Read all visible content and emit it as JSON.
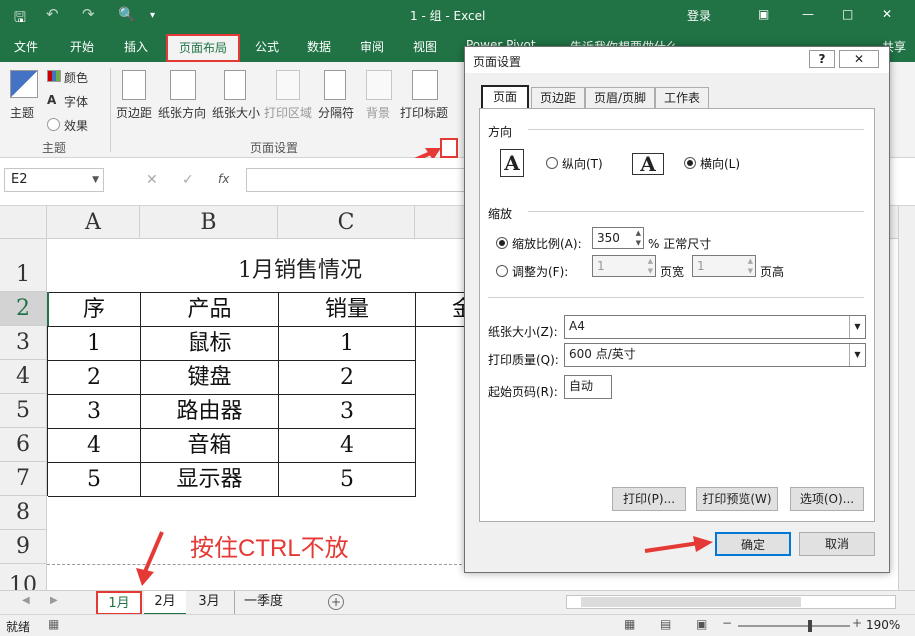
{
  "titlebar": {
    "title": "1 - 组 - Excel",
    "login": "登录"
  },
  "menu": {
    "file": "文件",
    "home": "开始",
    "insert": "插入",
    "pagelayout": "页面布局",
    "formulas": "公式",
    "data": "数据",
    "review": "审阅",
    "view": "视图",
    "powerpivot": "Power Pivot",
    "tellme": "告诉我你想要做什么",
    "share": "共享"
  },
  "ribbon": {
    "theme": "主题",
    "colors": "颜色",
    "fonts": "字体",
    "effects": "效果",
    "group_theme": "主题",
    "margins": "页边距",
    "orientation": "纸张方向",
    "size": "纸张大小",
    "printarea": "打印区域",
    "breaks": "分隔符",
    "background": "背景",
    "printtitles": "打印标题",
    "group_pagesetup": "页面设置"
  },
  "formulabar": {
    "namebox": "E2",
    "fx": "fx"
  },
  "sheet": {
    "columns": [
      "A",
      "B",
      "C"
    ],
    "rows": [
      "1",
      "2",
      "3",
      "4",
      "5",
      "6",
      "7",
      "8",
      "9",
      "10"
    ],
    "title": "1月销售情况",
    "header": [
      "序",
      "产品",
      "销量",
      "金"
    ],
    "data": [
      [
        "1",
        "鼠标",
        "1"
      ],
      [
        "2",
        "键盘",
        "2"
      ],
      [
        "3",
        "路由器",
        "3"
      ],
      [
        "4",
        "音箱",
        "4"
      ],
      [
        "5",
        "显示器",
        "5"
      ]
    ],
    "annotation": "按住CTRL不放"
  },
  "sheettabs": [
    "1月",
    "2月",
    "3月",
    "一季度"
  ],
  "status": {
    "ready": "就绪",
    "zoom": "190%"
  },
  "dialog": {
    "title": "页面设置",
    "help": "?",
    "tabs": [
      "页面",
      "页边距",
      "页眉/页脚",
      "工作表"
    ],
    "orientation_label": "方向",
    "portrait": "纵向(T)",
    "landscape": "横向(L)",
    "scaling_label": "缩放",
    "adjust_to": "缩放比例(A):",
    "scale_value": "350",
    "normal_size": "% 正常尺寸",
    "fit_to": "调整为(F):",
    "fit_wide": "1",
    "pages_wide": "页宽",
    "fit_tall": "1",
    "pages_tall": "页高",
    "paper_size_label": "纸张大小(Z):",
    "paper_size": "A4",
    "print_quality_label": "打印质量(Q):",
    "print_quality": "600 点/英寸",
    "first_page_label": "起始页码(R):",
    "first_page": "自动",
    "print_btn": "打印(P)...",
    "preview_btn": "打印预览(W)",
    "options_btn": "选项(O)...",
    "ok_btn": "确定",
    "cancel_btn": "取消"
  },
  "colors": {
    "excel_green": "#217346",
    "highlight_red": "#e53935"
  }
}
